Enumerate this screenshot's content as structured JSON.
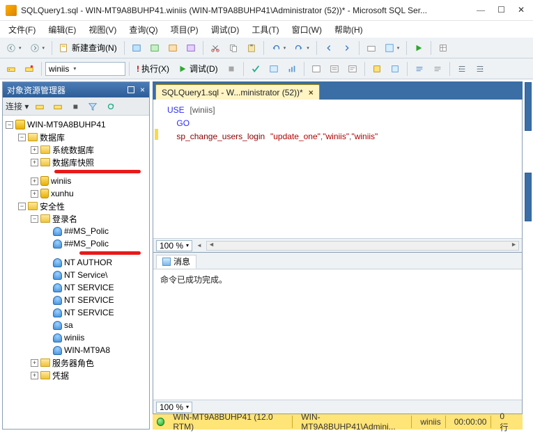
{
  "window": {
    "title": "SQLQuery1.sql - WIN-MT9A8BUHP41.winiis (WIN-MT9A8BUHP41\\Administrator (52))* - Microsoft SQL Ser..."
  },
  "menu": {
    "file": "文件(F)",
    "edit": "编辑(E)",
    "view": "视图(V)",
    "query": "查询(Q)",
    "project": "项目(P)",
    "debug": "调试(D)",
    "tools": "工具(T)",
    "window": "窗口(W)",
    "help": "帮助(H)"
  },
  "toolbar1": {
    "new_query": "新建查询(N)"
  },
  "toolbar2": {
    "db_combo": "winiis",
    "execute": "执行(X)",
    "debug": "调试(D)"
  },
  "object_explorer": {
    "title": "对象资源管理器",
    "connect_label": "连接 ▾",
    "root": "WIN-MT9A8BUHP41",
    "databases": "数据库",
    "sys_db": "系统数据库",
    "db_snaps": "数据库快照",
    "db1": "winiis",
    "db2": "xunhu",
    "security": "安全性",
    "logins": "登录名",
    "login_items": [
      "##MS_Polic",
      "##MS_Polic",
      "NT AUTHOR",
      "NT Service\\",
      "NT SERVICE",
      "NT SERVICE",
      "NT SERVICE",
      "sa",
      "winiis",
      "WIN-MT9A8"
    ],
    "server_roles": "服务器角色",
    "credentials": "凭据"
  },
  "tab": {
    "label": "SQLQuery1.sql - W...ministrator (52))*"
  },
  "editor": {
    "line1_kw": "USE",
    "line1_obj": "[winiis]",
    "line2": "GO",
    "line3_proc": "sp_change_users_login",
    "line3_arg1": "\"update_one\"",
    "line3_arg2": "\"winiis\"",
    "line3_arg3": "\"winiis\"",
    "zoom": "100 %"
  },
  "results": {
    "tab": "消息",
    "message": "命令已成功完成。",
    "zoom": "100 %"
  },
  "status": {
    "server": "WIN-MT9A8BUHP41 (12.0 RTM)",
    "user": "WIN-MT9A8BUHP41\\Admini...",
    "db": "winiis",
    "time": "00:00:00",
    "rows": "0 行"
  }
}
